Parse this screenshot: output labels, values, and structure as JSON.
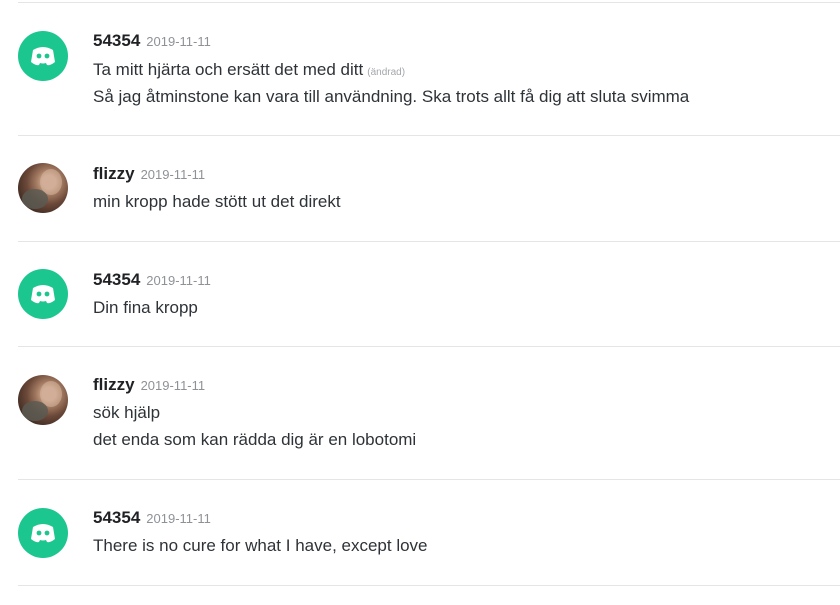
{
  "messages": [
    {
      "username": "54354",
      "timestamp": "2019-11-11",
      "avatar": "discord-default-icon",
      "lines": [
        "Ta mitt hjärta och ersätt det med ditt",
        "Så jag åtminstone kan vara till användning. Ska trots allt få dig att sluta svimma"
      ],
      "edited_label": "(ändrad)"
    },
    {
      "username": "flizzy",
      "timestamp": "2019-11-11",
      "avatar": "user-photo",
      "lines": [
        "min kropp hade stött ut det direkt"
      ]
    },
    {
      "username": "54354",
      "timestamp": "2019-11-11",
      "avatar": "discord-default-icon",
      "lines": [
        "Din fina kropp"
      ]
    },
    {
      "username": "flizzy",
      "timestamp": "2019-11-11",
      "avatar": "user-photo",
      "lines": [
        "sök hjälp",
        "det enda som kan rädda dig är en lobotomi"
      ]
    },
    {
      "username": "54354",
      "timestamp": "2019-11-11",
      "avatar": "discord-default-icon",
      "lines": [
        "There is no cure for what I have, except love"
      ]
    }
  ],
  "colors": {
    "discord_avatar_bg": "#1cc68f",
    "divider": "#e3e5e8",
    "timestamp": "#8e9297"
  }
}
